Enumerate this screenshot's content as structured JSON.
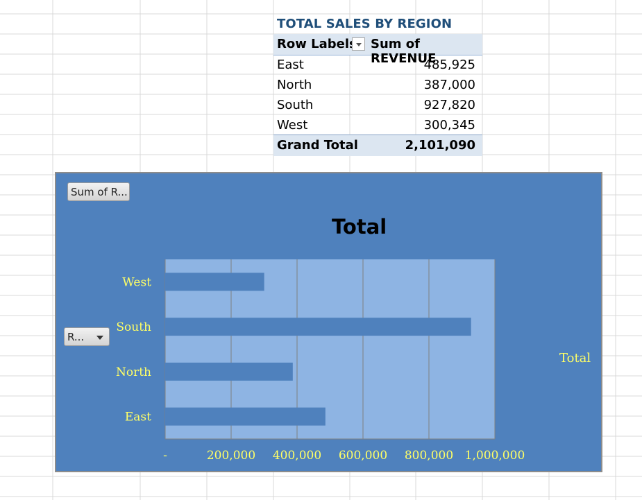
{
  "pivot_table": {
    "title": "TOTAL SALES BY REGION",
    "header": {
      "row_labels": "Row Labels",
      "sum_label": "Sum of REVENUE"
    },
    "rows": [
      {
        "label": "East",
        "value": "485,925"
      },
      {
        "label": "North",
        "value": "387,000"
      },
      {
        "label": "South",
        "value": "927,820"
      },
      {
        "label": "West",
        "value": "300,345"
      }
    ],
    "grand_total": {
      "label": "Grand Total",
      "value": "2,101,090"
    }
  },
  "chart": {
    "field_button_value": "Sum of R...",
    "field_button_row": "R...",
    "legend_entry": "Total"
  },
  "colors": {
    "chart_background": "#4f81bd",
    "plot_area": "#8eb4e3",
    "bar": "#4f81bd",
    "axis_label": "#ffff66",
    "pivot_header": "#dce6f1",
    "pivot_title": "#1f4e79"
  },
  "chart_data": {
    "type": "bar",
    "orientation": "horizontal",
    "title": "Total",
    "categories": [
      "East",
      "North",
      "South",
      "West"
    ],
    "series": [
      {
        "name": "Total",
        "values": [
          485925,
          387000,
          927820,
          300345
        ]
      }
    ],
    "xlim": [
      0,
      1000000
    ],
    "x_ticks": [
      0,
      200000,
      400000,
      600000,
      800000,
      1000000
    ],
    "x_tick_labels": [
      "-",
      "200,000",
      "400,000",
      "600,000",
      "800,000",
      "1,000,000"
    ],
    "grid": true,
    "legend": "right"
  }
}
